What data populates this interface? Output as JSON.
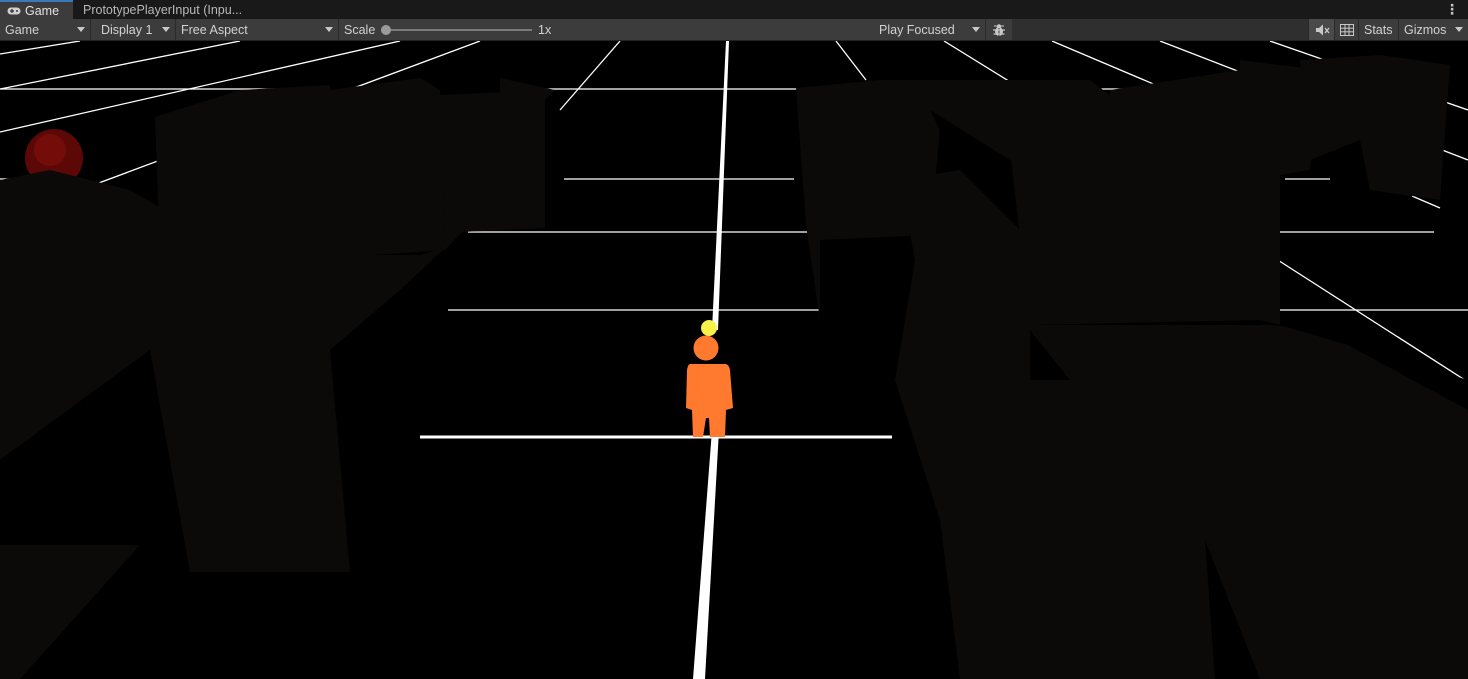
{
  "tabs": [
    {
      "label": "Game",
      "icon": "gamepad-icon",
      "active": true
    },
    {
      "label": "PrototypePlayerInput (Inpu...",
      "active": false
    }
  ],
  "toolbar": {
    "view_select": "Game",
    "display_select": "Display 1",
    "aspect_select": "Free Aspect",
    "scale_label": "Scale",
    "scale_value": "1x",
    "scale_fraction": 0.0,
    "play_mode_select": "Play Focused",
    "bug_icon": "bug-icon",
    "mute_icon": "mute-audio-icon",
    "grid_icon": "grid-icon",
    "stats_label": "Stats",
    "gizmos_label": "Gizmos"
  },
  "colors": {
    "tab_active_bg": "#3c3c3c",
    "tab_accent": "#3a79bb",
    "toolbar_bg": "#3c3c3c",
    "scene_background": "#000000",
    "scene_blocks": "#0b0a09",
    "player_body": "#ff7a2f",
    "player_marker": "#f7f24a",
    "red_sphere": "#6a0a08",
    "lines": "#ffffff"
  },
  "scene": {
    "objects": [
      "player-character",
      "player-marker",
      "red-sphere",
      "ground-grid-lines",
      "shadow-blocks"
    ]
  }
}
